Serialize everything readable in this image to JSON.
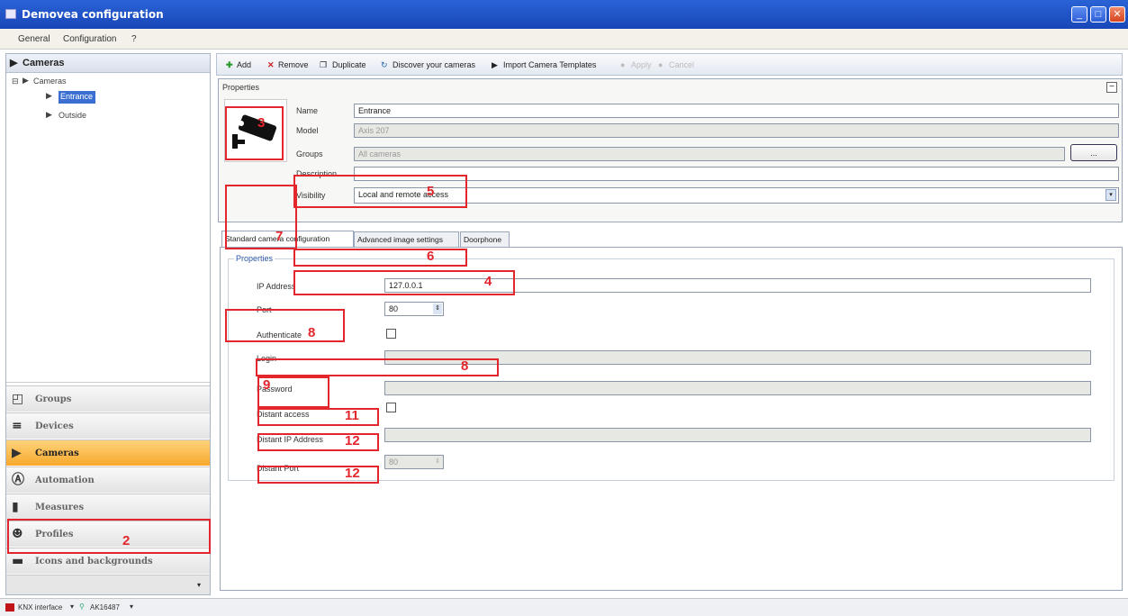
{
  "window": {
    "title": "Demovea configuration"
  },
  "menu": [
    "General",
    "Configuration",
    "?"
  ],
  "left": {
    "header": "Cameras",
    "tree": {
      "root": "Cameras",
      "children": [
        "Entrance",
        "Outside"
      ]
    },
    "nav": [
      "Groups",
      "Devices",
      "Cameras",
      "Automation",
      "Measures",
      "Profiles",
      "Icons and backgrounds"
    ]
  },
  "toolbar": {
    "add": "Add",
    "remove": "Remove",
    "duplicate": "Duplicate",
    "discover": "Discover your cameras",
    "import": "Import Camera Templates",
    "apply": "Apply",
    "cancel": "Cancel"
  },
  "properties": {
    "title": "Properties",
    "name_label": "Name",
    "name_value": "Entrance",
    "model_label": "Model",
    "model_value": "Axis 207",
    "groups_label": "Groups",
    "groups_value": "All cameras",
    "groups_btn": "...",
    "description_label": "Description",
    "visibility_label": "Visibility",
    "visibility_value": "Local and remote access"
  },
  "tabs": [
    "Standard camera configuration",
    "Advanced image settings",
    "Doorphone"
  ],
  "camera_props": {
    "title": "Properties",
    "ip_label": "IP Address",
    "ip_value": "127.0.0.1",
    "port_label": "Port",
    "port_value": "80",
    "auth_label": "Authenticate",
    "login_label": "Login",
    "password_label": "Password",
    "distant_access_label": "Distant access",
    "distant_ip_label": "Distant IP Address",
    "distant_port_label": "Distant Port",
    "distant_port_value": "80"
  },
  "annotations": [
    "3",
    "5",
    "7",
    "6",
    "4",
    "8",
    "8",
    "9",
    "11",
    "12",
    "12",
    "2"
  ],
  "status": {
    "knx": "KNX interface",
    "device": "AK16487"
  },
  "colors": {
    "title_bar": "#1846b8",
    "annotation_red": "#e3262c",
    "active_nav": "#f7a82c"
  }
}
